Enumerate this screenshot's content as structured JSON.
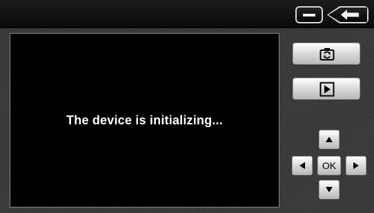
{
  "screen": {
    "message": "The device is initializing..."
  },
  "titlebar": {
    "minimize_icon": "minimize-icon",
    "back_icon": "back-arrow-icon"
  },
  "controls": {
    "camera_icon": "camera-switch-icon",
    "play_icon": "play-icon",
    "dpad": {
      "up_icon": "arrow-up-icon",
      "down_icon": "arrow-down-icon",
      "left_icon": "arrow-left-icon",
      "right_icon": "arrow-right-icon",
      "ok_label": "OK"
    }
  },
  "colors": {
    "background": "#3a3a3a",
    "screen": "#000000",
    "text": "#ffffff",
    "button_face": "#d6d6d6"
  }
}
